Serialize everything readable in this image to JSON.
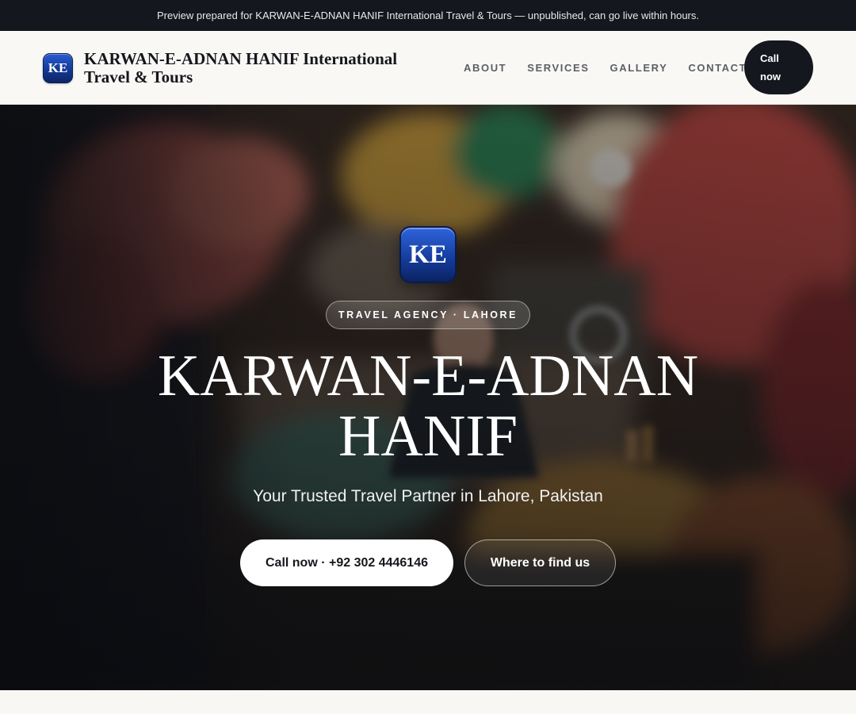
{
  "preview_banner": {
    "text": "Preview prepared for KARWAN-E-ADNAN HANIF International Travel & Tours — unpublished, can go live within hours."
  },
  "header": {
    "logo_text": "KE",
    "brand_name": "KARWAN-E-ADNAN HANIF International Travel & Tours",
    "nav": [
      {
        "label": "ABOUT"
      },
      {
        "label": "SERVICES"
      },
      {
        "label": "GALLERY"
      },
      {
        "label": "CONTACT"
      }
    ],
    "call_button": "Call now"
  },
  "hero": {
    "logo_text": "KE",
    "eyebrow": "TRAVEL AGENCY · LAHORE",
    "title": "KARWAN-E-ADNAN HANIF",
    "subtitle": "Your Trusted Travel Partner in Lahore, Pakistan",
    "primary_button": "Call now · +92 302 4446146",
    "secondary_button": "Where to find us"
  },
  "colors": {
    "banner_bg": "#14171d",
    "header_bg": "#f9f8f5",
    "accent_dark": "#14171d",
    "logo_blue": "#153ea0",
    "hero_text": "#ffffff"
  }
}
